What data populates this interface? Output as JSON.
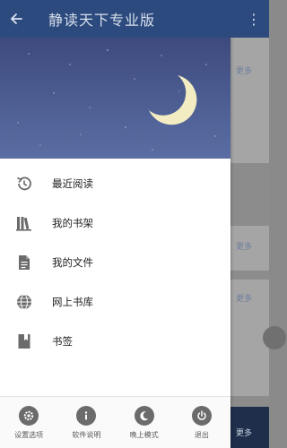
{
  "app_bar": {
    "title": "静读天下专业版",
    "back_icon": "arrow-left-icon",
    "more_icon": "more-vert-icon"
  },
  "background": {
    "more_label": "更多"
  },
  "drawer": {
    "header_icon": "crescent-moon-icon",
    "menu": [
      {
        "label": "最近阅读",
        "icon": "history-icon"
      },
      {
        "label": "我的书架",
        "icon": "bookshelf-icon"
      },
      {
        "label": "我的文件",
        "icon": "file-icon"
      },
      {
        "label": "网上书库",
        "icon": "globe-icon"
      },
      {
        "label": "书签",
        "icon": "bookmark-icon"
      }
    ],
    "footer": [
      {
        "label": "设置选项",
        "icon": "settings-icon"
      },
      {
        "label": "软件说明",
        "icon": "info-icon"
      },
      {
        "label": "晚上模式",
        "icon": "night-mode-icon"
      },
      {
        "label": "退出",
        "icon": "power-icon"
      }
    ]
  },
  "colors": {
    "app_bar": "#2c4a7e",
    "header_start": "#3e4a7d",
    "header_end": "#5a6ea3",
    "moon": "#f3ecc3"
  }
}
